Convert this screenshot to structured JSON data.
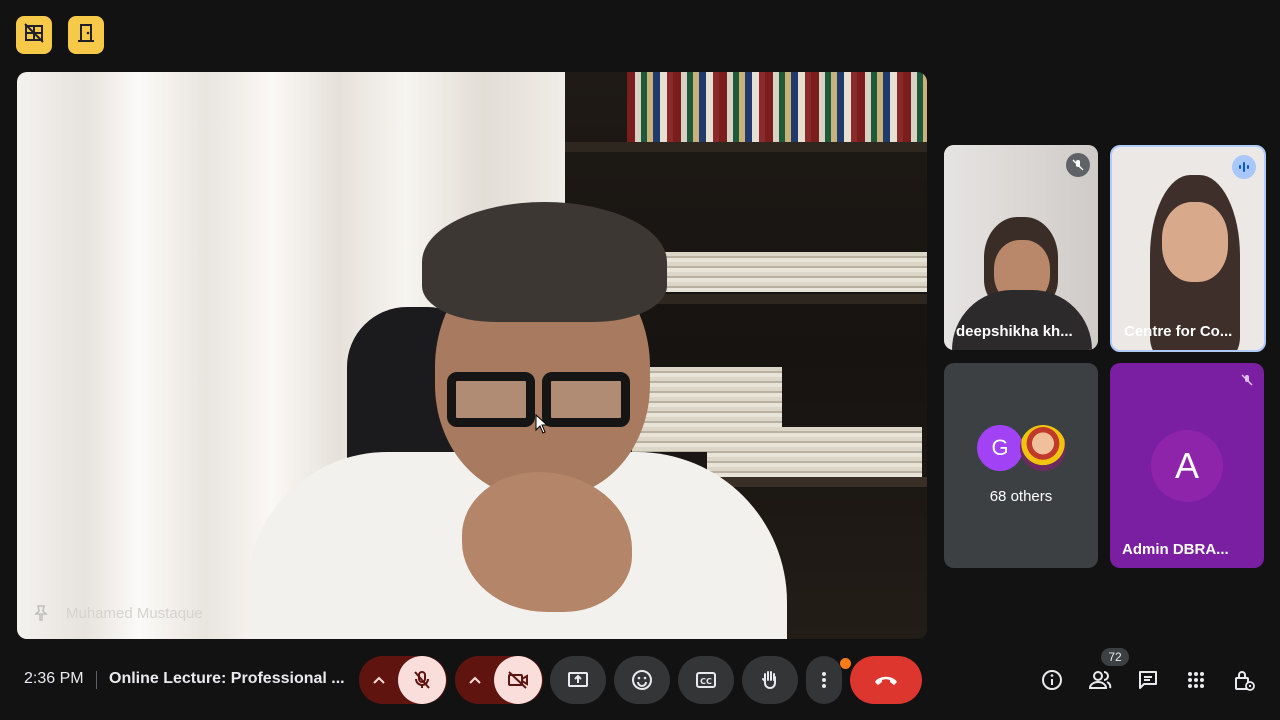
{
  "main_video": {
    "participant_name": "Muhamed Mustaque"
  },
  "tiles": [
    {
      "name": "deepshikha kh...",
      "muted": true
    },
    {
      "name": "Centre for Co...",
      "speaking": true
    },
    {
      "avatar_letter": "G",
      "label": "68 others"
    },
    {
      "avatar_letter": "A",
      "name": "Admin DBRA...",
      "muted": true
    }
  ],
  "bottom_bar": {
    "time": "2:36 PM",
    "meeting_title": "Online Lecture: Professional ...",
    "participant_count": "72"
  },
  "colors": {
    "accent_yellow": "#f7c948",
    "leave_red": "#dc362e",
    "admin_tile": "#7b1fa2",
    "g_avatar": "#a142f4"
  },
  "icons": {
    "top_left": [
      "no-video-grid-icon",
      "door-exit-icon"
    ],
    "controls": [
      "chevron-up-icon",
      "mic-off-icon",
      "chevron-up-icon",
      "camera-off-icon",
      "present-screen-icon",
      "emoji-icon",
      "captions-icon",
      "raise-hand-icon",
      "more-options-icon",
      "end-call-icon"
    ],
    "right": [
      "info-icon",
      "people-icon",
      "chat-icon",
      "activities-icon",
      "host-controls-icon"
    ]
  }
}
